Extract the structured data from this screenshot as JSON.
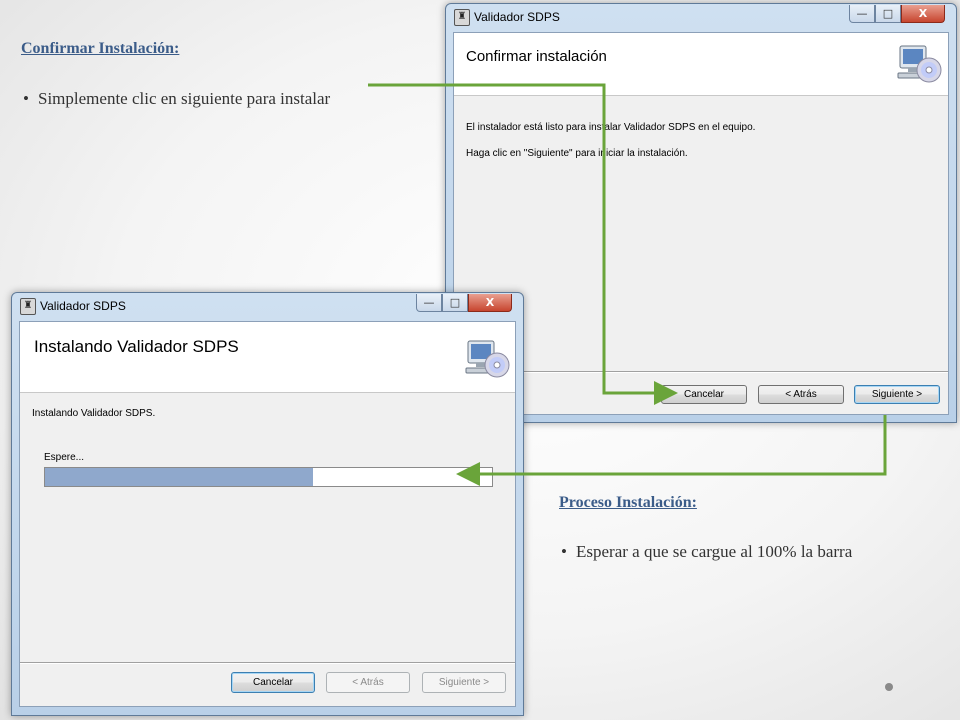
{
  "notes": {
    "confirm": {
      "title": "Confirmar Instalación:",
      "bullet": "Simplemente clic en siguiente para instalar"
    },
    "process": {
      "title": "Proceso Instalación:",
      "bullet": "Esperar a que se cargue al 100% la barra"
    }
  },
  "dialog_confirm": {
    "window_title": "Validador SDPS",
    "heading": "Confirmar instalación",
    "line1": "El instalador está listo para instalar Validador SDPS en el equipo.",
    "line2": "Haga clic en \"Siguiente\" para iniciar la instalación.",
    "buttons": {
      "cancel": "Cancelar",
      "back": "< Atrás",
      "next": "Siguiente >"
    },
    "controls": {
      "min": "—",
      "max": "□",
      "close": "X"
    }
  },
  "dialog_install": {
    "window_title": "Validador SDPS",
    "heading": "Instalando Validador SDPS",
    "status": "Instalando Validador SDPS.",
    "progress_label": "Espere...",
    "progress_fraction": 0.6,
    "buttons": {
      "cancel": "Cancelar",
      "back": "< Atrás",
      "next": "Siguiente >"
    },
    "controls": {
      "min": "—",
      "max": "□",
      "close": "X"
    }
  },
  "colors": {
    "arrow": "#6aa43a",
    "note_title": "#3b5c89",
    "progress_fill": "#8fa8cc"
  },
  "icons": [
    "application-icon",
    "computer-cd-icon",
    "minimize-icon",
    "maximize-icon",
    "close-icon",
    "arrow-connector-icon"
  ]
}
